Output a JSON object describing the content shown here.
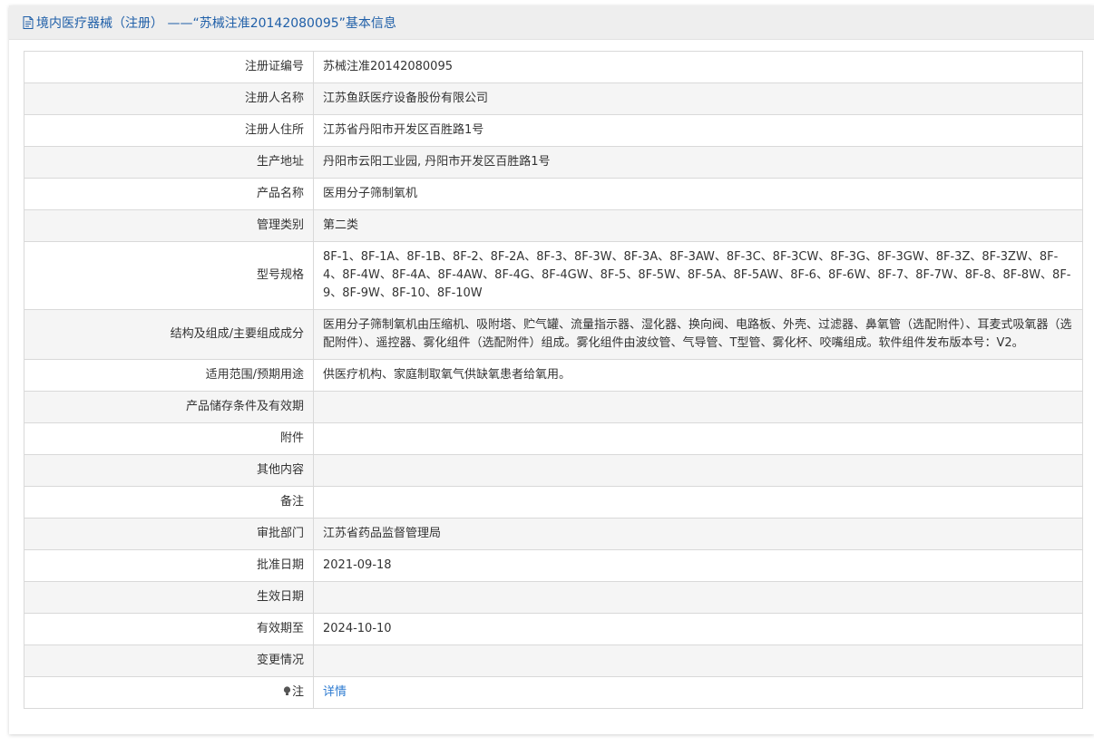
{
  "header": {
    "icon": "document-icon",
    "title": "境内医疗器械（注册） ——“苏械注准20142080095”基本信息"
  },
  "rows": [
    {
      "label": "注册证编号",
      "value": "苏械注准20142080095"
    },
    {
      "label": "注册人名称",
      "value": "江苏鱼跃医疗设备股份有限公司"
    },
    {
      "label": "注册人住所",
      "value": "江苏省丹阳市开发区百胜路1号"
    },
    {
      "label": "生产地址",
      "value": "丹阳市云阳工业园, 丹阳市开发区百胜路1号"
    },
    {
      "label": "产品名称",
      "value": "医用分子筛制氧机"
    },
    {
      "label": "管理类别",
      "value": "第二类"
    },
    {
      "label": "型号规格",
      "value": "8F-1、8F-1A、8F-1B、8F-2、8F-2A、8F-3、8F-3W、8F-3A、8F-3AW、8F-3C、8F-3CW、8F-3G、8F-3GW、8F-3Z、8F-3ZW、8F-4、8F-4W、8F-4A、8F-4AW、8F-4G、8F-4GW、8F-5、8F-5W、8F-5A、8F-5AW、8F-6、8F-6W、8F-7、8F-7W、8F-8、8F-8W、8F-9、8F-9W、8F-10、8F-10W"
    },
    {
      "label": "结构及组成/主要组成成分",
      "value": "医用分子筛制氧机由压缩机、吸附塔、贮气罐、流量指示器、湿化器、换向阀、电路板、外壳、过滤器、鼻氧管（选配附件）、耳麦式吸氧器（选配附件）、遥控器、雾化组件（选配附件）组成。雾化组件由波纹管、气导管、T型管、雾化杯、咬嘴组成。软件组件发布版本号：V2。"
    },
    {
      "label": "适用范围/预期用途",
      "value": "供医疗机构、家庭制取氧气供缺氧患者给氧用。"
    },
    {
      "label": "产品储存条件及有效期",
      "value": ""
    },
    {
      "label": "附件",
      "value": ""
    },
    {
      "label": "其他内容",
      "value": ""
    },
    {
      "label": "备注",
      "value": ""
    },
    {
      "label": "审批部门",
      "value": "江苏省药品监督管理局"
    },
    {
      "label": "批准日期",
      "value": "2021-09-18"
    },
    {
      "label": "生效日期",
      "value": ""
    },
    {
      "label": "有效期至",
      "value": "2024-10-10"
    },
    {
      "label": "变更情况",
      "value": ""
    }
  ],
  "note_row": {
    "icon": "lightbulb-icon",
    "label": "注",
    "link_text": "详情",
    "link_color": "#2d7bd1"
  }
}
